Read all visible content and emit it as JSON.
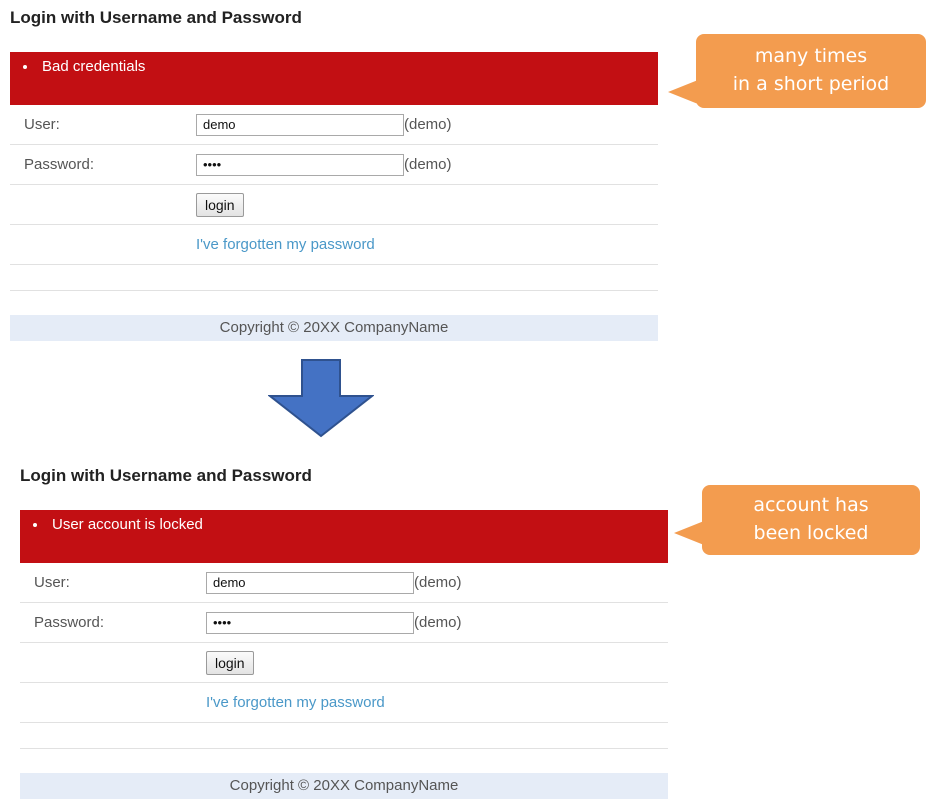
{
  "colors": {
    "error_bg": "#c20f13",
    "callout_bg": "#f39c4f",
    "footer_bg": "#e5ecf7",
    "link": "#4a98c8",
    "arrow": "#4472c4"
  },
  "before": {
    "title": "Login with Username and Password",
    "error": "Bad credentials",
    "user_label": "User:",
    "user_value": "demo",
    "user_hint": "(demo)",
    "password_label": "Password:",
    "password_value": "demo",
    "password_hint": "(demo)",
    "login_button": "login",
    "forgot_link": "I've forgotten my password",
    "footer": "Copyright © 20XX CompanyName"
  },
  "after": {
    "title": "Login with Username and Password",
    "error": "User account is locked",
    "user_label": "User:",
    "user_value": "demo",
    "user_hint": "(demo)",
    "password_label": "Password:",
    "password_value": "demo",
    "password_hint": "(demo)",
    "login_button": "login",
    "forgot_link": "I've forgotten my password",
    "footer": "Copyright © 20XX CompanyName"
  },
  "callouts": {
    "top_line1": "many times",
    "top_line2": "in a short period",
    "bottom_line1": "account has",
    "bottom_line2": "been locked"
  },
  "arrow_icon": "down-arrow"
}
